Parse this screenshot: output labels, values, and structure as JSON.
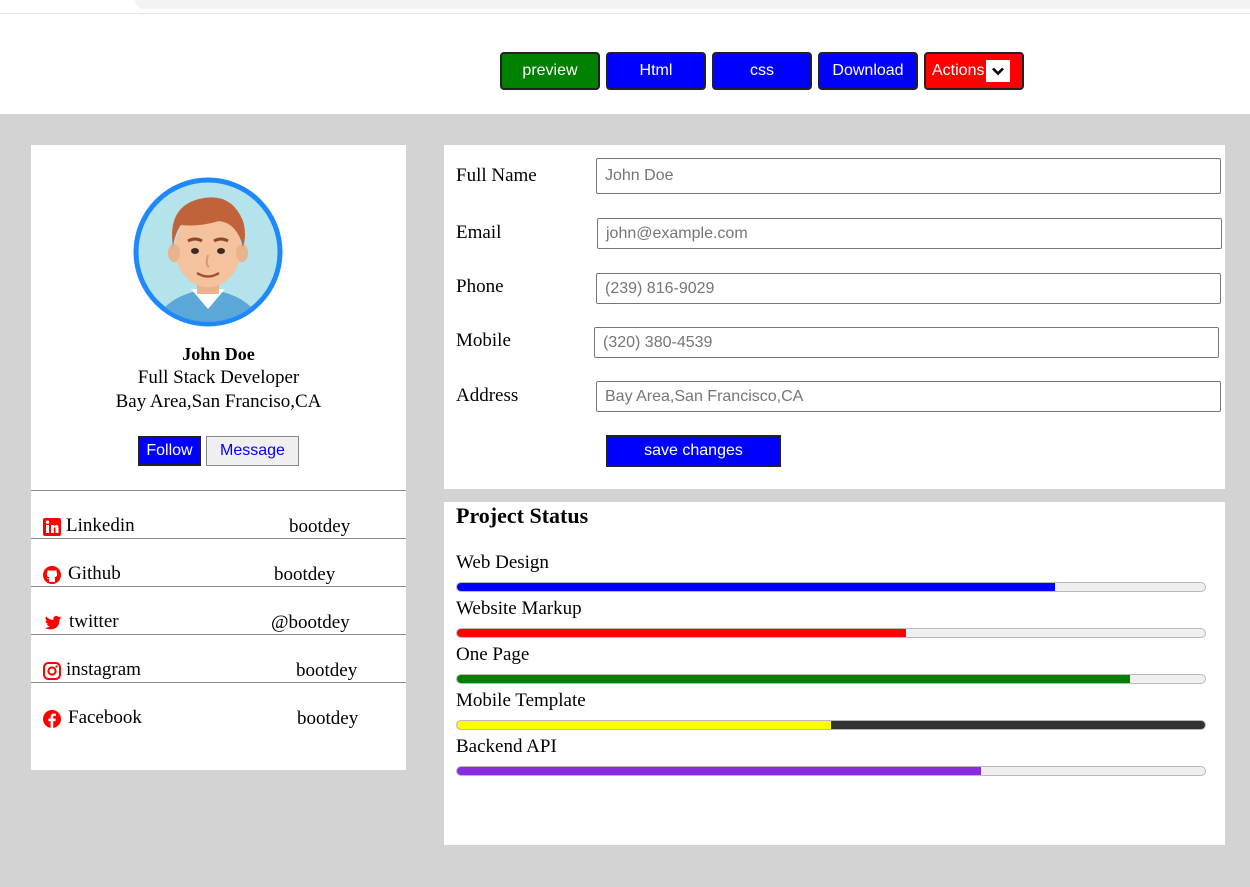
{
  "toolbar": {
    "preview_label": "preview",
    "html_label": "Html",
    "css_label": "css",
    "download_label": "Download",
    "actions_label": "Actions"
  },
  "profile": {
    "name": "John Doe",
    "role": "Full Stack Developer",
    "location": "Bay Area,San Franciso,CA",
    "follow_label": "Follow",
    "message_label": "Message"
  },
  "social": [
    {
      "name": "Linkedin",
      "handle": "bootdey",
      "icon": "linkedin-icon"
    },
    {
      "name": "Github",
      "handle": "bootdey",
      "icon": "github-icon"
    },
    {
      "name": "twitter",
      "handle": "@bootdey",
      "icon": "twitter-icon"
    },
    {
      "name": "instagram",
      "handle": "bootdey",
      "icon": "instagram-icon"
    },
    {
      "name": "Facebook",
      "handle": "bootdey",
      "icon": "facebook-icon"
    }
  ],
  "form": {
    "full_name_label": "Full Name",
    "full_name_value": "John Doe",
    "email_label": "Email",
    "email_value": "john@example.com",
    "phone_label": "Phone",
    "phone_value": "(239) 816-9029",
    "mobile_label": "Mobile",
    "mobile_value": "(320) 380-4539",
    "address_label": "Address",
    "address_value": "Bay Area,San Francisco,CA",
    "save_label": "save changes"
  },
  "project_status": {
    "title": "Project Status",
    "items": [
      {
        "label": "Web Design",
        "percent": 80,
        "color": "#0000ff",
        "track": "#efefef"
      },
      {
        "label": "Website Markup",
        "percent": 60,
        "color": "#ff0000",
        "track": "#efefef"
      },
      {
        "label": "One Page",
        "percent": 90,
        "color": "#008000",
        "track": "#efefef"
      },
      {
        "label": "Mobile Template",
        "percent": 50,
        "color": "#ffff00",
        "track": "#333333"
      },
      {
        "label": "Backend API",
        "percent": 70,
        "color": "#8a2be2",
        "track": "#efefef"
      }
    ]
  },
  "colors": {
    "page_background": "#d3d3d3",
    "primary_blue": "#0000ff",
    "preview_green": "#008000",
    "actions_red": "#ff0000",
    "social_icon_red": "#ff0000",
    "avatar_ring": "#1e88ff"
  }
}
